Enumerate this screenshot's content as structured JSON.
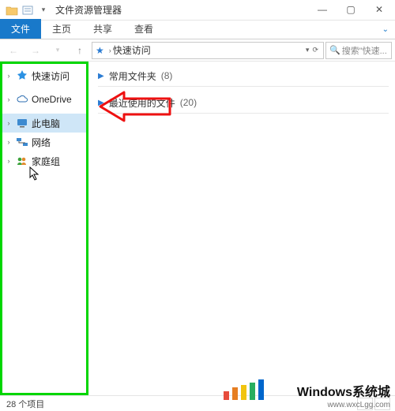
{
  "window": {
    "title": "文件资源管理器",
    "controls": {
      "min": "—",
      "max": "▢",
      "close": "✕"
    }
  },
  "ribbon": {
    "file": "文件",
    "home": "主页",
    "share": "共享",
    "view": "查看"
  },
  "nav_arrows": {
    "back": "←",
    "forward": "→",
    "up": "↑"
  },
  "address": {
    "star": "★",
    "caret": "›",
    "location": "快速访问",
    "refresh": "⟳"
  },
  "search": {
    "icon": "🔍",
    "placeholder": "搜索\"快速..."
  },
  "nav_items": [
    {
      "label": "快速访问",
      "icon": "star",
      "expandable": true
    },
    {
      "label": "OneDrive",
      "icon": "cloud",
      "expandable": true
    },
    {
      "label": "此电脑",
      "icon": "pc",
      "expandable": true,
      "selected": true
    },
    {
      "label": "网络",
      "icon": "net",
      "expandable": true
    },
    {
      "label": "家庭组",
      "icon": "home",
      "expandable": true
    }
  ],
  "content": {
    "group1_label": "常用文件夹",
    "group1_count": "(8)",
    "group2_label": "最近使用的文件",
    "group2_count": "(20)"
  },
  "status": {
    "text": "28 个项目"
  },
  "watermark": {
    "brand": "Windows系统城",
    "url": "www.wxcLgg.com"
  }
}
